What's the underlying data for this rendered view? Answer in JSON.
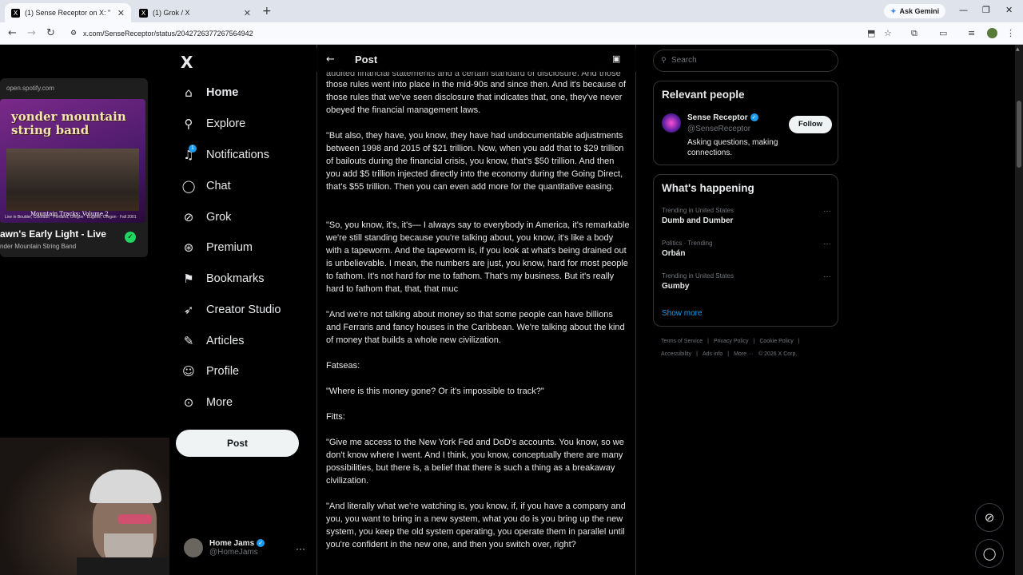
{
  "browser": {
    "tabs": [
      {
        "label": "(1) Sense Receptor on X: \"",
        "fav": "X"
      },
      {
        "label": "(1) Grok / X",
        "fav": "X"
      }
    ],
    "gemini_label": "Ask Gemini",
    "url": "x.com/SenseReceptor/status/2042726377267564942"
  },
  "nav": {
    "logo": "X",
    "items": [
      {
        "label": "Home",
        "icon": "home-icon"
      },
      {
        "label": "Explore",
        "icon": "search-icon"
      },
      {
        "label": "Notifications",
        "icon": "bell-icon"
      },
      {
        "label": "Chat",
        "icon": "chat-icon"
      },
      {
        "label": "Grok",
        "icon": "grok-icon"
      },
      {
        "label": "Premium",
        "icon": "premium-icon"
      },
      {
        "label": "Bookmarks",
        "icon": "bookmark-icon"
      },
      {
        "label": "Creator Studio",
        "icon": "rocket-icon"
      },
      {
        "label": "Articles",
        "icon": "article-icon"
      },
      {
        "label": "Profile",
        "icon": "person-icon"
      },
      {
        "label": "More",
        "icon": "more-icon"
      }
    ],
    "notif_count": "1",
    "post_button": "Post",
    "account": {
      "name": "Home Jams",
      "handle": "@HomeJams"
    }
  },
  "spotify": {
    "url": "open.spotify.com",
    "album_title": "yonder mountain string band",
    "album_sub": "Mountain Tracks: Volume 2",
    "album_foot": "Live in Boulder, Colorado · Portland, Oregon · Eugene, Oregon · Fall 2001",
    "track": "awn's Early Light - Live",
    "artist": "nder Mountain String Band"
  },
  "post": {
    "title": "Post",
    "paragraphs": [
      "audited financial statements and a certain standard of disclosure. And those rules went into place in the mid-90s and since then. And it's because of those rules that we've seen disclosure that indicates that, one, they've never obeyed the financial management laws.",
      "\"But also, they have, you know, they have had undocumentable adjustments between 1998 and 2015 of $21 trillion. Now, when you add that to $29 trillion of bailouts during the financial crisis, you know, that's $50 trillion. And then you add $5 trillion injected directly into the economy during the Going Direct, that's $55 trillion. Then you can even add more for the quantitative easing.",
      "\"So, you know, it's, it's— I always say to everybody in America, it's remarkable we're still standing because you're talking about, you know, it's like a body with a tapeworm. And the tapeworm is, if you look at what's being drained out is unbelievable. I mean, the numbers are just, you know, hard for most people to fathom. It's not hard for me to fathom. That's my business. But it's really hard to fathom that, that, that muc",
      "\"And we're not talking about money so that some people can have billions and Ferraris and fancy houses in the Caribbean. We're talking about the kind of money that builds a whole new civilization.",
      "Fatseas:",
      "\"Where is this money gone? Or it's impossible to track?\"",
      "Fitts:",
      "\"Give me access to the New York Fed and DoD's accounts. You know, so we don't know where I went. And I think, you know, conceptually there are many possibilities, but there is, a belief that there is such a thing as a breakaway civilization.",
      "\"And literally what we're watching is, you know, if, if you have a company and you, you want to bring in a new system, what you do is you bring up the new system, you keep the old system operating, you operate them in parallel until you're confident in the new one, and then you switch over, right?"
    ]
  },
  "right": {
    "search_placeholder": "Search",
    "relevant_title": "Relevant people",
    "person": {
      "name": "Sense Receptor",
      "handle": "@SenseReceptor",
      "bio": "Asking questions, making connections.",
      "follow": "Follow"
    },
    "happening_title": "What's happening",
    "trends": [
      {
        "context": "Trending in United States",
        "name": "Dumb and Dumber"
      },
      {
        "context": "Politics · Trending",
        "name": "Orbán"
      },
      {
        "context": "Trending in United States",
        "name": "Gumby"
      }
    ],
    "show_more": "Show more",
    "footer_line1": [
      "Terms of Service",
      "|",
      "Privacy Policy",
      "|",
      "Cookie Policy",
      "|"
    ],
    "footer_line2": [
      "Accessibility",
      "|",
      "Ads info",
      "|",
      "More ···",
      "© 2026 X Corp."
    ]
  },
  "colors": {
    "accent": "#1d9bf0",
    "background": "#000000",
    "text": "#e7e9ea",
    "muted": "#71767b"
  }
}
